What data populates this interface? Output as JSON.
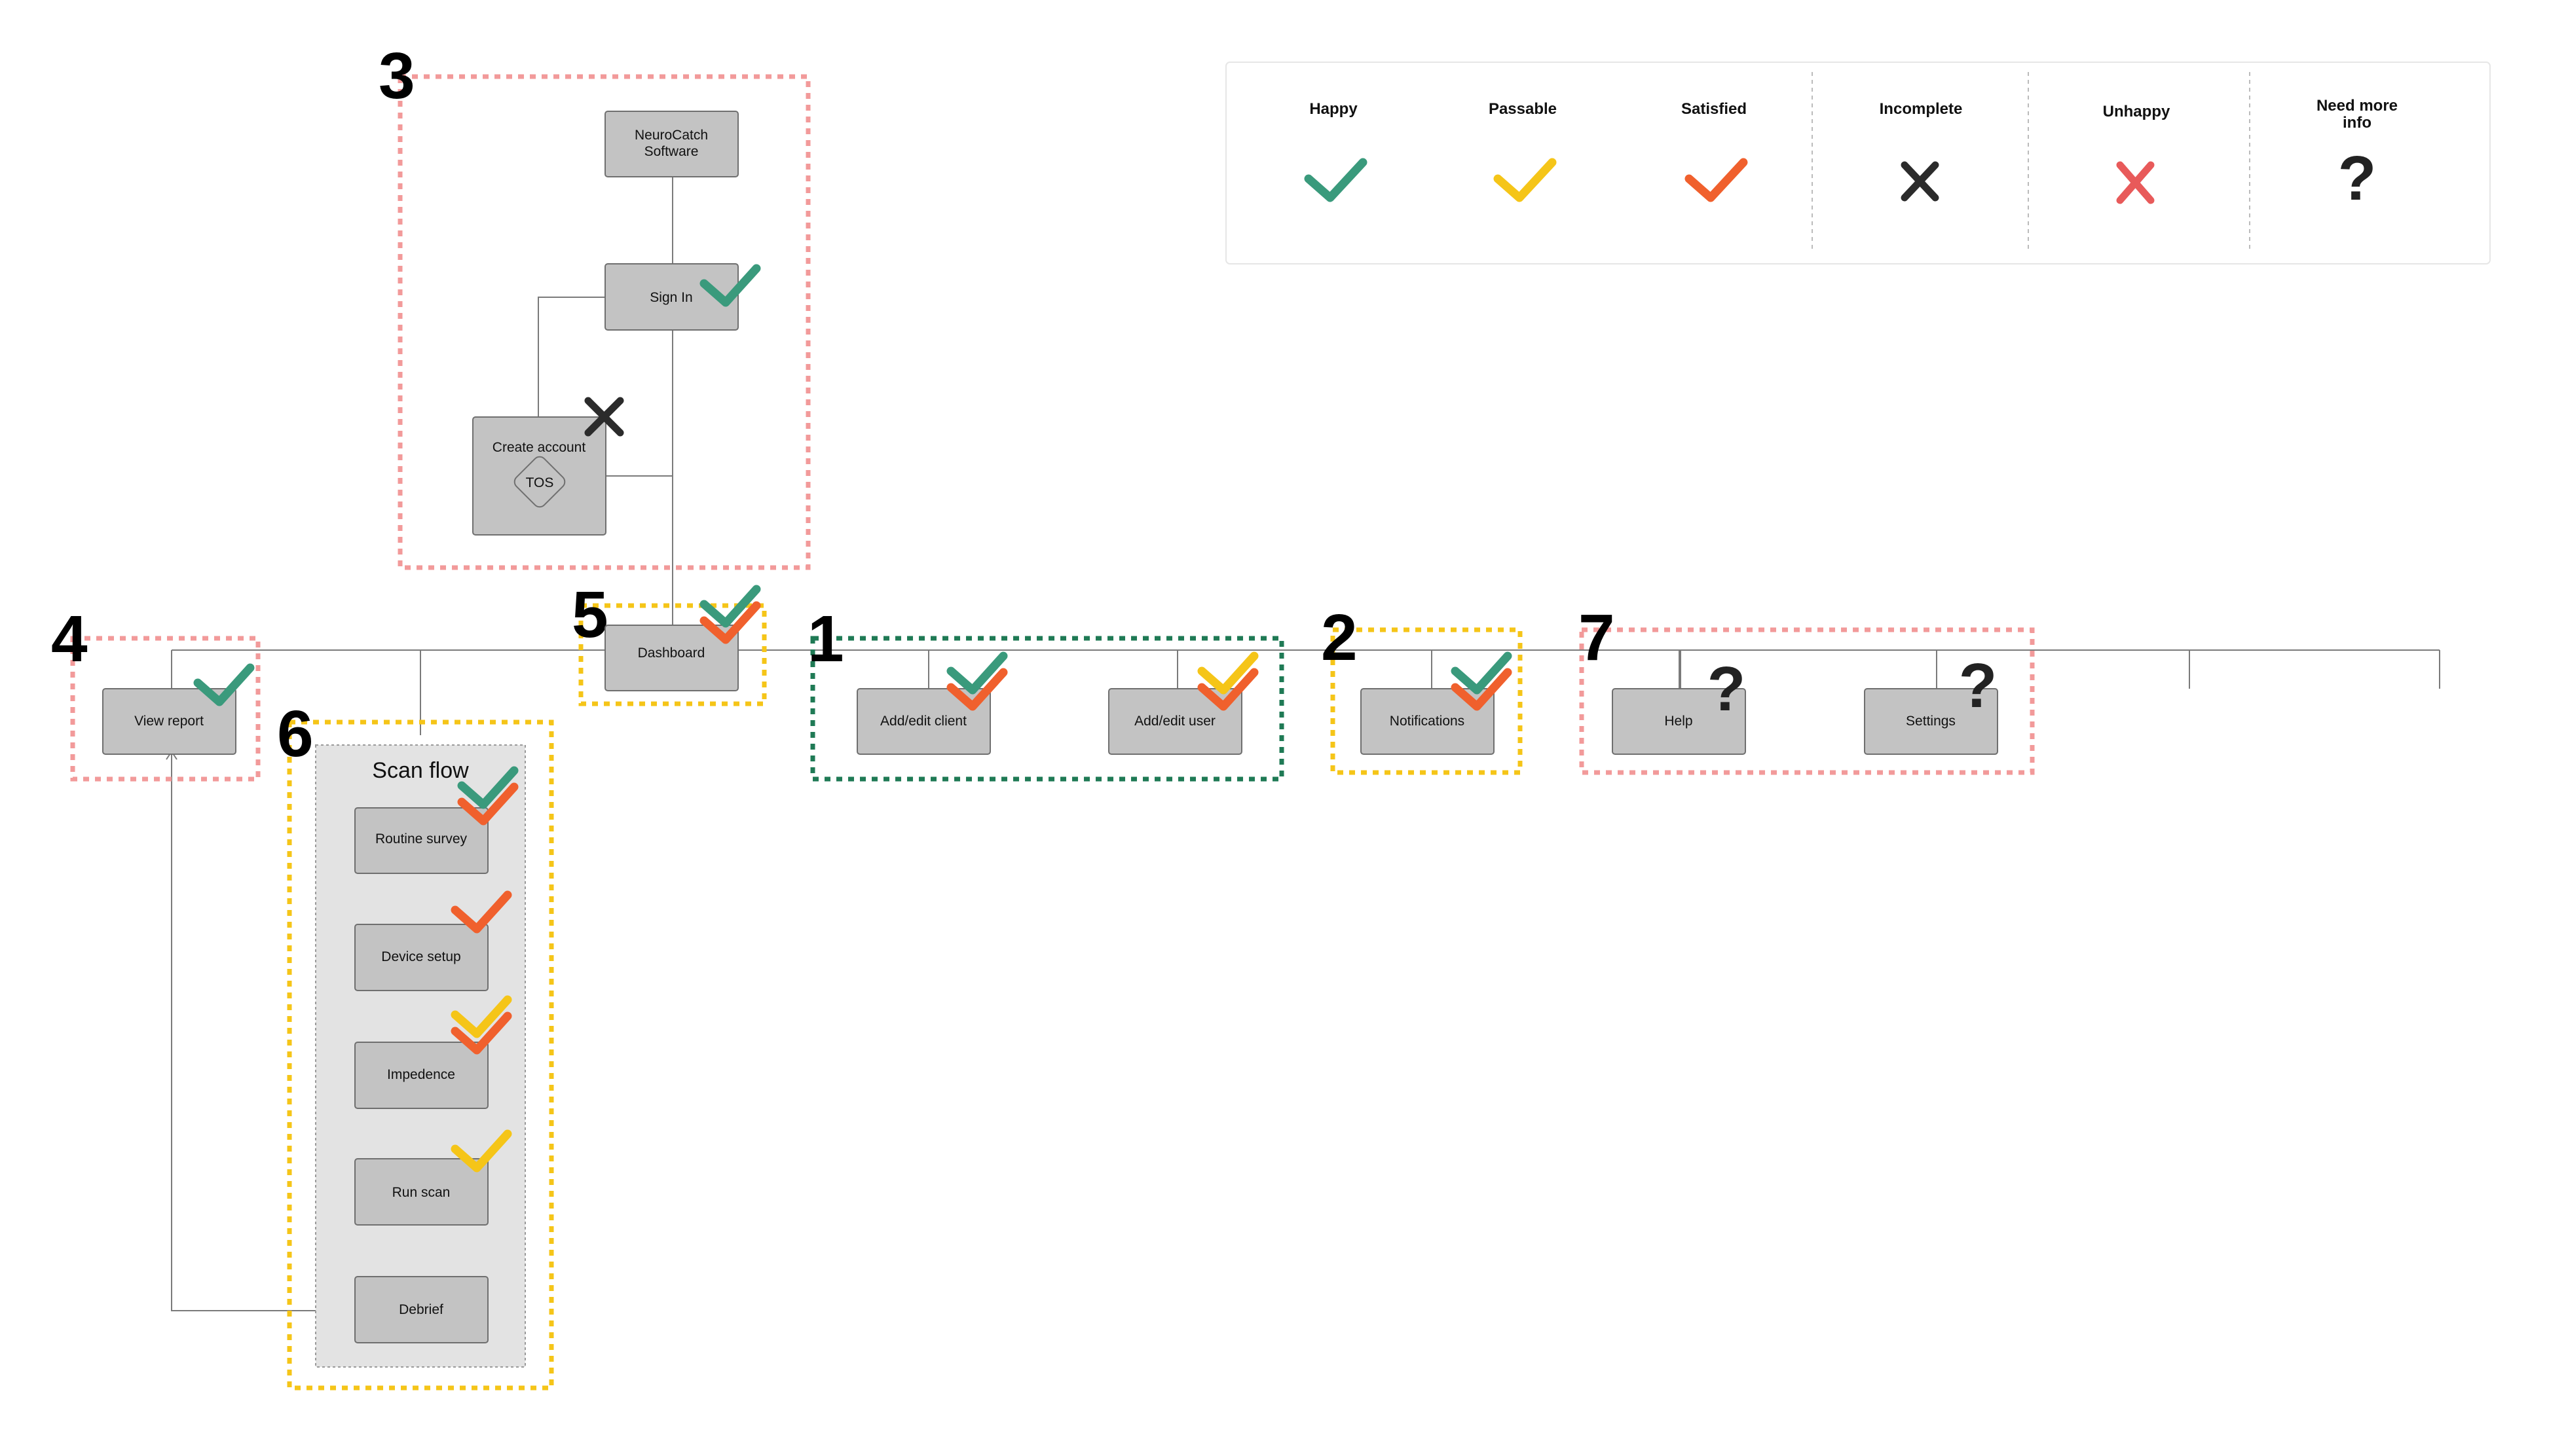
{
  "colors": {
    "happy": "#3a9a7c",
    "passable": "#f5c518",
    "satisfied": "#f0602d",
    "incomplete": "#2b2b2b",
    "unhappy": "#e85a5a",
    "need_more_info": "#222222"
  },
  "legend": {
    "happy": "Happy",
    "passable": "Passable",
    "satisfied": "Satisfied",
    "incomplete": "Incomplete",
    "unhappy": "Unhappy",
    "need_more_info_line1": "Need more",
    "need_more_info_line2": "info",
    "question_mark": "?"
  },
  "group_numbers": {
    "g1": "1",
    "g2": "2",
    "g3": "3",
    "g4": "4",
    "g5": "5",
    "g6": "6",
    "g7": "7"
  },
  "nodes": {
    "neurocatch_line1": "NeuroCatch",
    "neurocatch_line2": "Software",
    "sign_in": "Sign In",
    "create_account": "Create account",
    "tos": "TOS",
    "dashboard": "Dashboard",
    "view_report": "View report",
    "add_edit_client": "Add/edit client",
    "add_edit_user": "Add/edit user",
    "notifications": "Notifications",
    "help": "Help",
    "settings": "Settings",
    "routine_survey": "Routine survey",
    "device_setup": "Device setup",
    "impedence": "Impedence",
    "run_scan": "Run scan",
    "debrief": "Debrief"
  },
  "scan_flow_title": "Scan flow",
  "ratings": {
    "sign_in": [
      "happy"
    ],
    "create_account": [
      "incomplete"
    ],
    "dashboard": [
      "happy",
      "satisfied"
    ],
    "view_report": [
      "happy"
    ],
    "add_edit_client": [
      "happy",
      "satisfied"
    ],
    "add_edit_user": [
      "passable",
      "satisfied"
    ],
    "notifications": [
      "happy",
      "satisfied"
    ],
    "help": [
      "need_more_info"
    ],
    "settings": [
      "need_more_info"
    ],
    "scan_flow": [
      "happy",
      "satisfied"
    ],
    "device_setup": [
      "satisfied"
    ],
    "impedence": [
      "passable",
      "satisfied"
    ],
    "run_scan": [
      "passable"
    ]
  }
}
